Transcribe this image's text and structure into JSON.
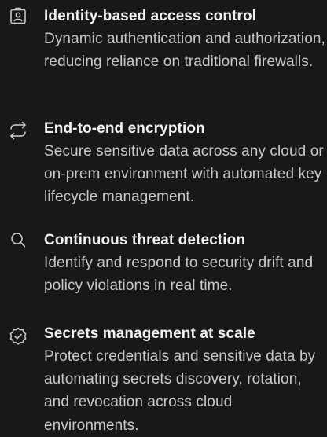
{
  "features": [
    {
      "icon": "id-badge-icon",
      "title": "Identity-based access control",
      "description": "Dynamic authentication and authorization, reducing reliance on traditional firewalls."
    },
    {
      "icon": "sync-arrows-icon",
      "title": "End-to-end encryption",
      "description": "Secure sensitive data across any cloud or on-prem environment with automated key lifecycle management."
    },
    {
      "icon": "search-icon",
      "title": "Continuous threat detection",
      "description": "Identify and respond to security drift and policy violations in real time."
    },
    {
      "icon": "verified-check-icon",
      "title": "Secrets management at scale",
      "description": "Protect credentials and sensitive data by automating secrets discovery, rotation, and revocation across cloud environments."
    }
  ],
  "colors": {
    "background": "#181818",
    "title": "#f2f2f2",
    "description": "#c9c9c9",
    "icon": "#d0d0d0"
  }
}
